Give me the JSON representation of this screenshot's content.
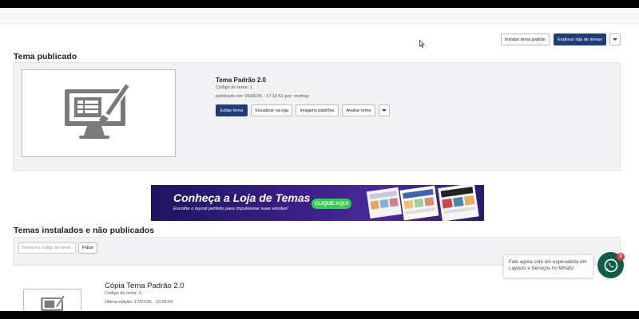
{
  "header": {
    "install_default_label": "Instalar tema padrão",
    "explore_store_label": "Explorar loja de temas"
  },
  "published": {
    "section_title": "Tema publicado",
    "theme_name": "Tema Padrão 2.0",
    "theme_code": "Código do tema: 1",
    "published_info": "publicado em: 05/06/25 - 17:16:51 por: roottray",
    "actions": {
      "edit": "Editar tema",
      "view_store": "Visualizar na loja",
      "default_images": "Imagens padrões",
      "rate": "Avaliar tema"
    }
  },
  "banner": {
    "title": "Conheça a Loja de Temas",
    "subtitle": "Escolhe o layout perfeito para impulsionar suas vendas!",
    "cta": "CLIQUE AQUI"
  },
  "installed": {
    "section_title": "Temas instalados e não publicados",
    "search_placeholder": "Nome ou código do tema",
    "filter_label": "Filtrar",
    "items": [
      {
        "name": "Cópia Tema Padrão 2.0",
        "code": "Código do tema: 3",
        "last_edit": "Última edição: 17/07/25 - 10:55:59"
      }
    ]
  },
  "chat": {
    "message": "Fale agora com um especialista em Layouts e Serviços no Whats!",
    "badge": "X"
  },
  "colors": {
    "primary": "#1f3d7a",
    "whatsapp": "#0f5c47",
    "banner_cta": "#2fd24b",
    "badge": "#e53935"
  }
}
